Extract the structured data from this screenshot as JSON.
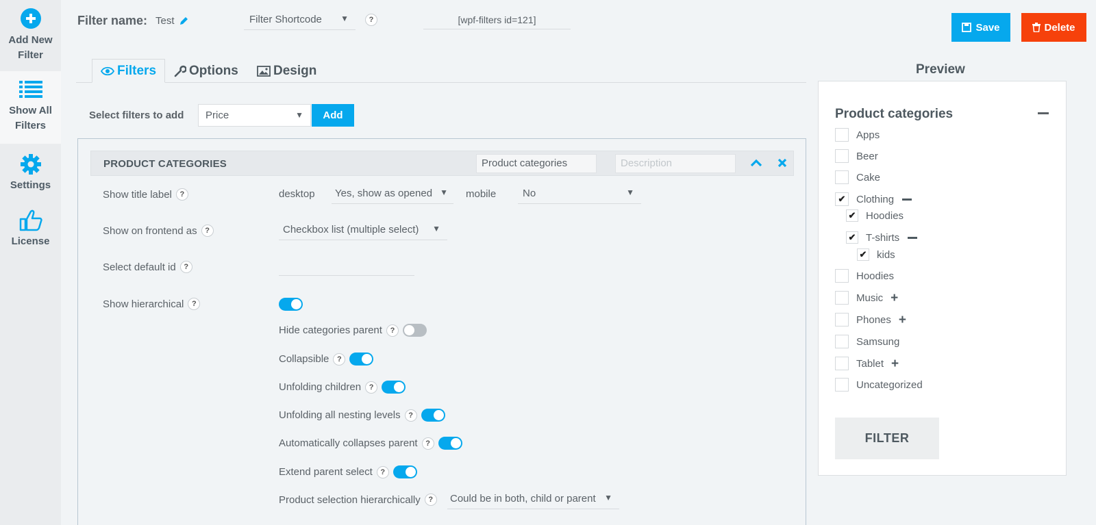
{
  "colors": {
    "accent": "#06a8ed",
    "danger": "#f6410b",
    "nav_bg": "#eaecee"
  },
  "nav": {
    "add_new": "Add New Filter",
    "show_all": "Show All Filters",
    "settings": "Settings",
    "license": "License"
  },
  "header": {
    "filter_name_label": "Filter name:",
    "filter_name_value": "Test",
    "shortcode_select": "Filter Shortcode",
    "shortcode_value": "[wpf-filters id=121]",
    "help": "?",
    "save": "Save",
    "delete": "Delete"
  },
  "tabs": {
    "filters": "Filters",
    "options": "Options",
    "design": "Design",
    "preview": "Preview"
  },
  "add_filter": {
    "label": "Select filters to add",
    "selected": "Price",
    "button": "Add"
  },
  "filter_block": {
    "title": "PRODUCT CATEGORIES",
    "title_input": "Product categories",
    "description_placeholder": "Description",
    "rows": {
      "show_title_label": "Show title label",
      "desktop": "desktop",
      "desktop_value": "Yes, show as opened",
      "mobile": "mobile",
      "mobile_value": "No",
      "show_on_frontend": "Show on frontend as",
      "frontend_value": "Checkbox list (multiple select)",
      "select_default_id": "Select default id",
      "show_hierarchical": "Show hierarchical",
      "hide_categories_parent": "Hide categories parent",
      "collapsible": "Collapsible",
      "unfolding_children": "Unfolding children",
      "unfolding_all": "Unfolding all nesting levels",
      "auto_collapses": "Automatically collapses parent",
      "extend_parent": "Extend parent select",
      "product_selection": "Product selection hierarchically",
      "product_selection_value": "Could be in both, child or parent"
    }
  },
  "preview": {
    "heading": "Product categories",
    "items": {
      "apps": "Apps",
      "beer": "Beer",
      "cake": "Cake",
      "clothing": "Clothing",
      "hoodies_child": "Hoodies",
      "tshirts": "T-shirts",
      "kids": "kids",
      "hoodies": "Hoodies",
      "music": "Music",
      "phones": "Phones",
      "samsung": "Samsung",
      "tablet": "Tablet",
      "uncategorized": "Uncategorized"
    },
    "filter_button": "FILTER"
  }
}
